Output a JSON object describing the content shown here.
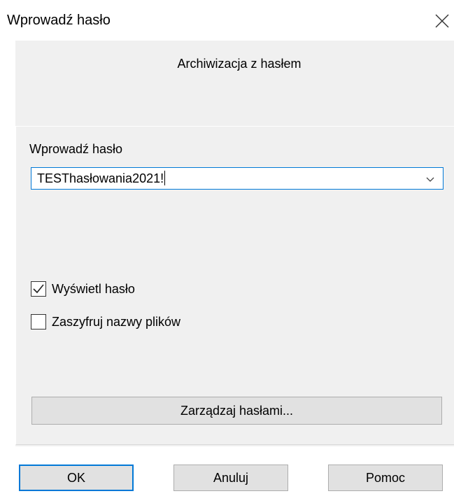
{
  "window": {
    "title": "Wprowadź hasło",
    "close_icon": "close-icon"
  },
  "dialog": {
    "subtitle": "Archiwizacja z hasłem",
    "password_label": "Wprowadź hasło",
    "password_value": "TESThasłowania2021!",
    "show_password": {
      "label": "Wyświetl hasło",
      "checked": true
    },
    "encrypt_filenames": {
      "label": "Zaszyfruj nazwy plików",
      "checked": false
    },
    "manage_button": "Zarządzaj hasłami..."
  },
  "buttons": {
    "ok": "OK",
    "cancel": "Anuluj",
    "help": "Pomoc"
  },
  "colors": {
    "accent": "#0078d7",
    "panel": "#f0f0f0",
    "button": "#e1e1e1"
  }
}
